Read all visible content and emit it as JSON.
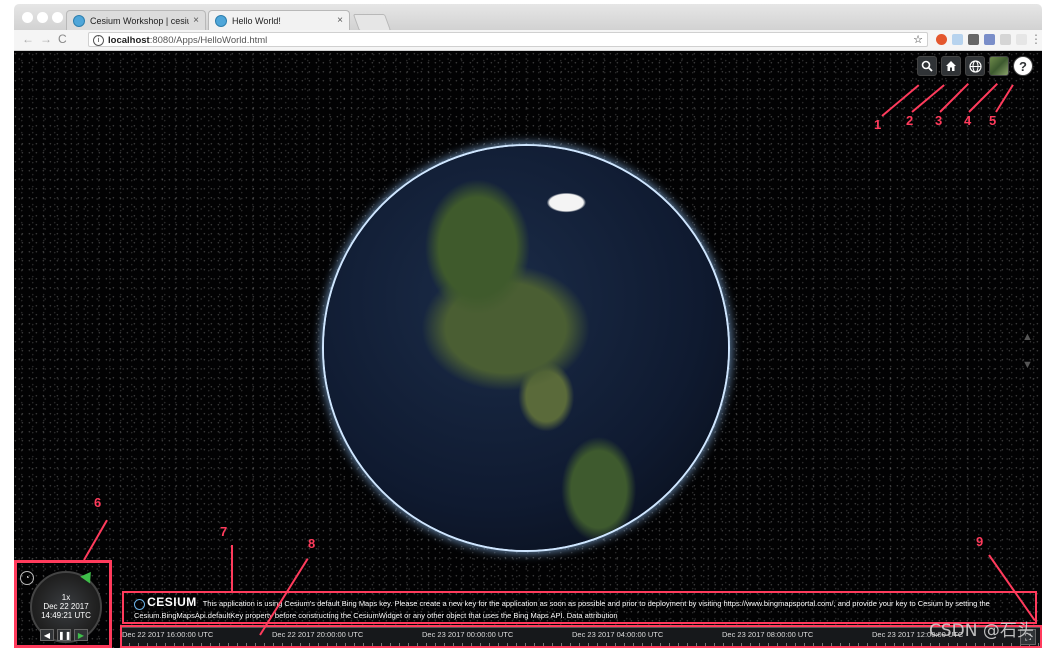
{
  "browser": {
    "tabs": [
      {
        "title": "Cesium Workshop | cesiumjs.c",
        "close": "×"
      },
      {
        "title": "Hello World!",
        "close": "×"
      }
    ],
    "url_host": "localhost",
    "url_rest": ":8080/Apps/HelloWorld.html",
    "nav": {
      "back": "←",
      "forward": "→",
      "reload": "C"
    },
    "star": "☆"
  },
  "cesium": {
    "toolbar": [
      {
        "icon": "search-icon",
        "glyph": "🔍"
      },
      {
        "icon": "home-icon",
        "glyph": "⌂"
      },
      {
        "icon": "globe-icon",
        "glyph": "◍"
      },
      {
        "icon": "imagery-icon",
        "glyph": ""
      },
      {
        "icon": "help-icon",
        "glyph": "?"
      }
    ],
    "animation": {
      "speed": "1x",
      "date": "Dec 22 2017",
      "time": "14:49:21 UTC",
      "buttons": {
        "reverse": "◀",
        "pause": "❚❚",
        "play": "▶"
      }
    },
    "credit": {
      "logo": "CESIUM",
      "text": "This application is using Cesium's default Bing Maps key. Please create a new key for the application as soon as possible and prior to deployment by visiting https://www.bingmapsportal.com/, and provide your key to Cesium by setting the Cesium.BingMapsApi.defaultKey property before constructing the CesiumWidget or any other object that uses the Bing Maps API. Data attribution"
    },
    "timeline_ticks": [
      "Dec 22 2017 16:00:00 UTC",
      "Dec 22 2017 20:00:00 UTC",
      "Dec 23 2017 00:00:00 UTC",
      "Dec 23 2017 04:00:00 UTC",
      "Dec 23 2017 08:00:00 UTC",
      "Dec 23 2017 12:00:00 UTC"
    ]
  },
  "annotations": [
    "1",
    "2",
    "3",
    "4",
    "5",
    "6",
    "7",
    "8",
    "9"
  ],
  "watermark": "CSDN @石头",
  "colors": {
    "annotation": "#ff3b5c",
    "space": "#020203"
  }
}
